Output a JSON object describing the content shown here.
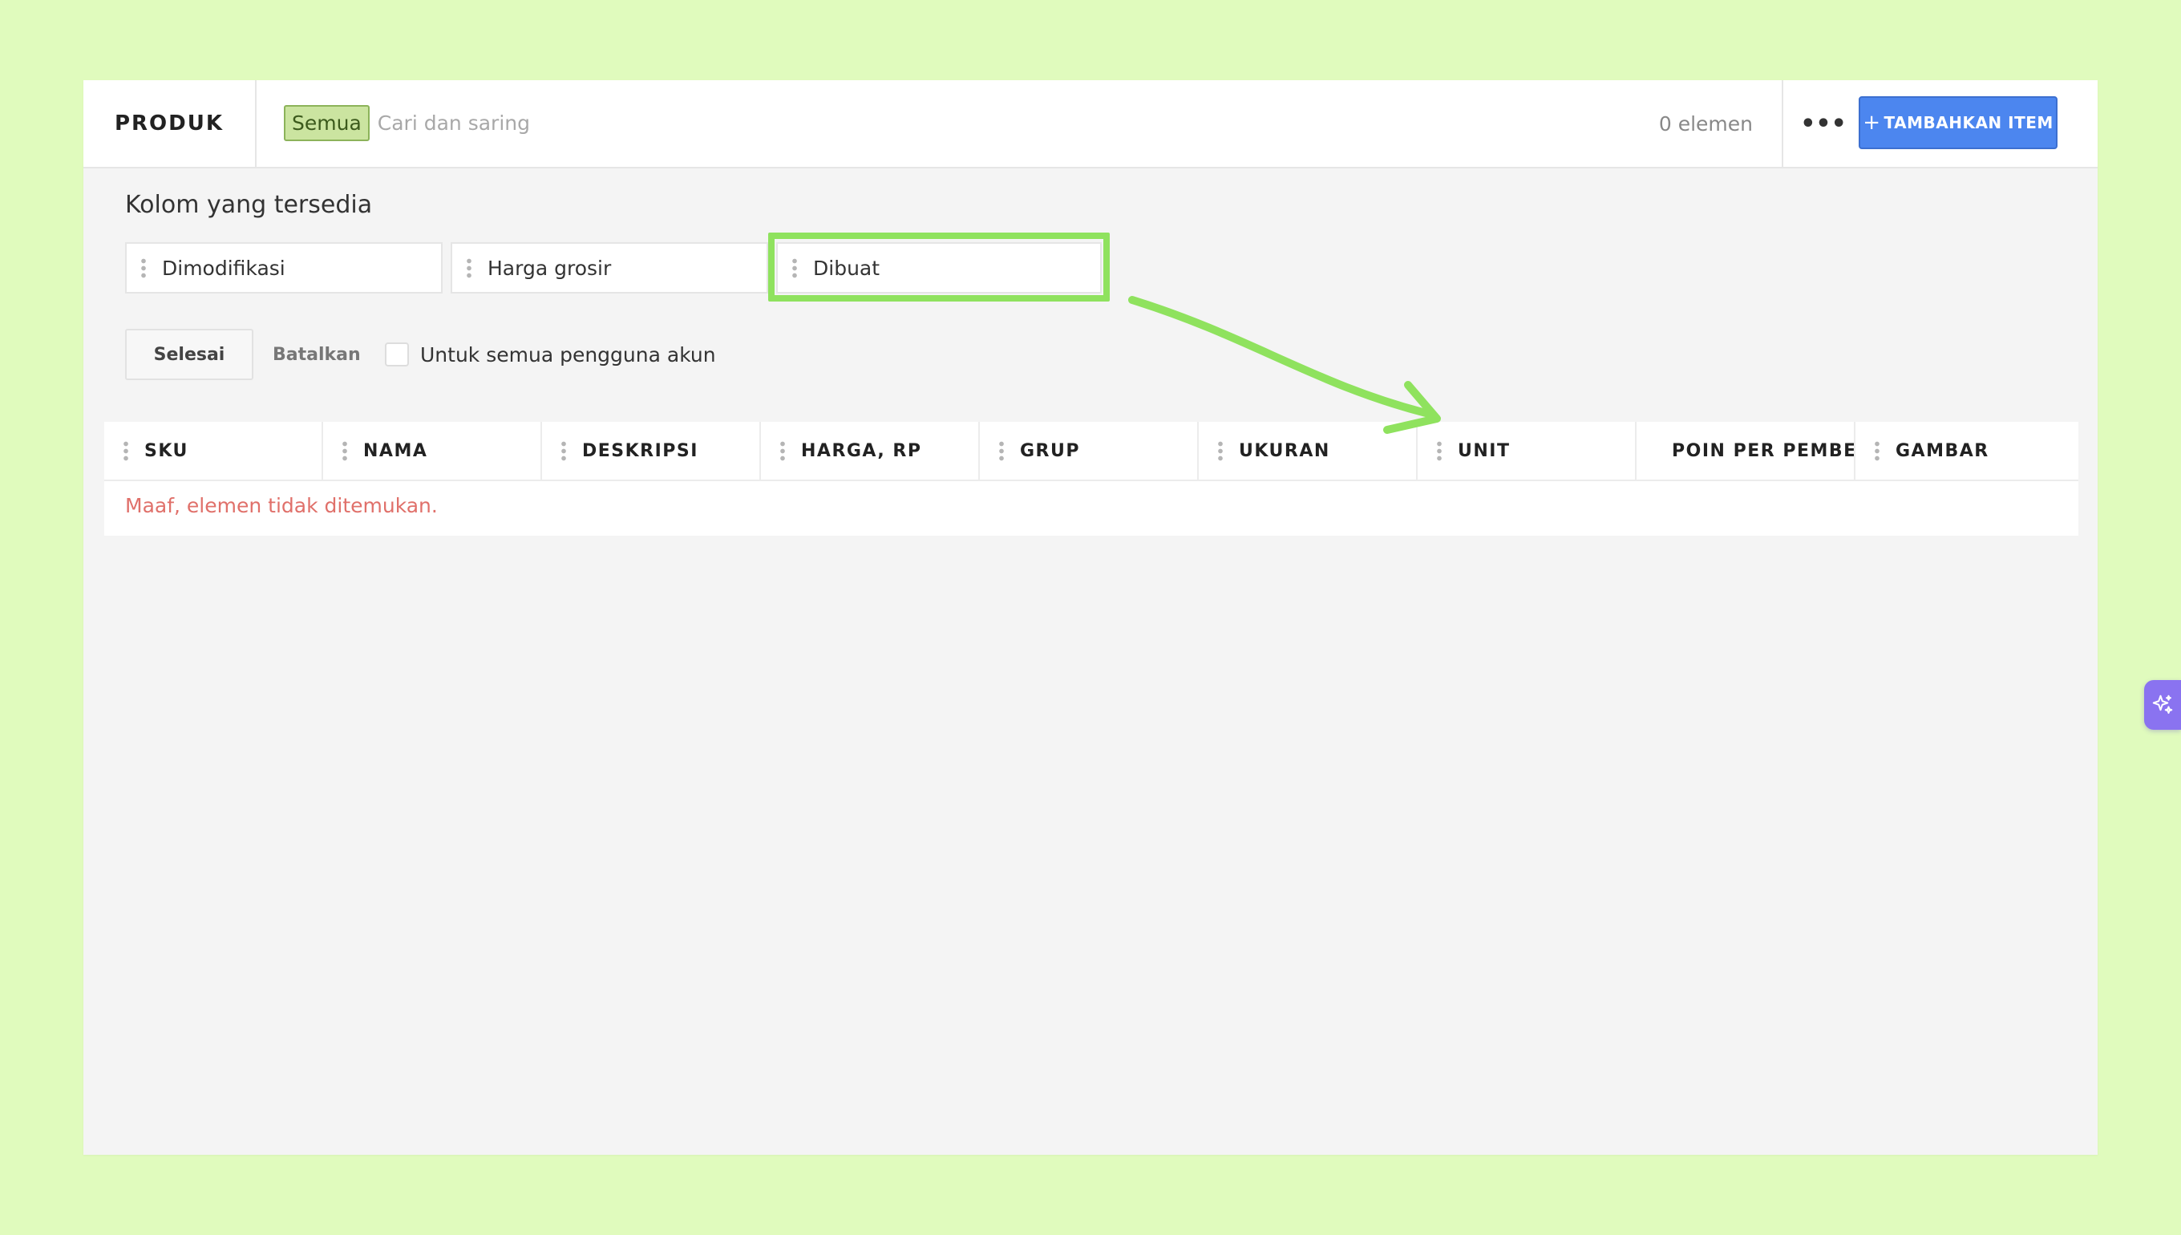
{
  "header": {
    "brand": "PRODUK",
    "filter_chip": "Semua",
    "search_placeholder": "Cari dan saring",
    "count": "0 elemen",
    "more_label": "•••",
    "add_button_plus": "+",
    "add_button_label": "TAMBAHKAN ITEM"
  },
  "columns_panel": {
    "title": "Kolom yang tersedia",
    "available": [
      "Dimodifikasi",
      "Harga grosir",
      "Dibuat"
    ],
    "done_label": "Selesai",
    "cancel_label": "Batalkan",
    "all_users_label": "Untuk semua pengguna akun"
  },
  "table": {
    "columns": [
      "SKU",
      "NAMA",
      "DESKRIPSI",
      "HARGA, RP",
      "GRUP",
      "UKURAN",
      "UNIT",
      "POIN PER PEMBELIAN",
      "GAMBAR"
    ],
    "empty_message": "Maaf, elemen tidak ditemukan."
  },
  "colors": {
    "background": "#e0fbbd",
    "accent": "#4c86ef",
    "highlight": "#8fe25e",
    "error_text": "#e0706a",
    "ai_button": "#8a73f0"
  },
  "icons": {
    "more": "more-horizontal-icon",
    "drag": "drag-handle-icon",
    "ai": "sparkles-icon"
  }
}
